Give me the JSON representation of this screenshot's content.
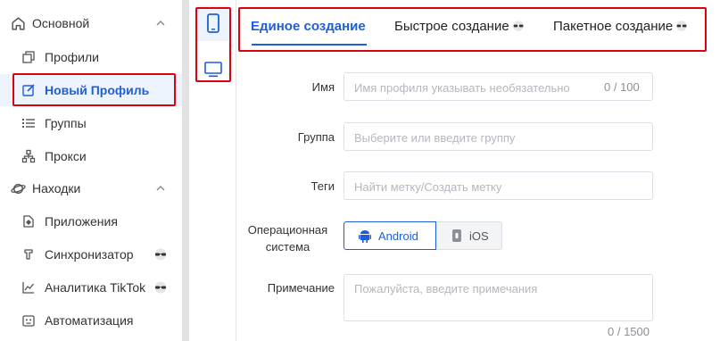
{
  "sidebar": {
    "groups": [
      {
        "label": "Основной",
        "icon": "home-icon"
      },
      {
        "label": "Находки",
        "icon": "planet-icon"
      }
    ],
    "items": [
      {
        "label": "Профили",
        "icon": "profiles-icon"
      },
      {
        "label": "Новый Профиль",
        "icon": "edit-icon",
        "active": true
      },
      {
        "label": "Группы",
        "icon": "list-icon"
      },
      {
        "label": "Прокси",
        "icon": "network-icon"
      },
      {
        "label": "Приложения",
        "icon": "apps-icon"
      },
      {
        "label": "Синхронизатор",
        "icon": "sync-icon",
        "badge": "vip-glasses-icon"
      },
      {
        "label": "Аналитика TikTok",
        "icon": "chart-icon",
        "badge": "vip-glasses-icon"
      },
      {
        "label": "Автоматизация",
        "icon": "robot-icon"
      }
    ]
  },
  "device_types": [
    {
      "icon": "phone-icon",
      "selected": true
    },
    {
      "icon": "desktop-icon",
      "selected": false
    }
  ],
  "tabs": [
    {
      "label": "Единое создание",
      "active": true
    },
    {
      "label": "Быстрое создание",
      "badge": "vip-glasses-icon"
    },
    {
      "label": "Пакетное создание",
      "badge": "vip-glasses-icon"
    }
  ],
  "form": {
    "name": {
      "label": "Имя",
      "placeholder": "Имя профиля указывать необязательно",
      "counter": "0 / 100"
    },
    "group": {
      "label": "Группа",
      "placeholder": "Выберите или введите группу"
    },
    "tags": {
      "label": "Теги",
      "placeholder": "Найти метку/Создать метку"
    },
    "os": {
      "label_line1": "Операционная",
      "label_line2": "система",
      "options": [
        {
          "label": "Android",
          "icon": "android-icon",
          "selected": true
        },
        {
          "label": "iOS",
          "icon": "apple-icon",
          "selected": false
        }
      ]
    },
    "note": {
      "label": "Примечание",
      "placeholder": "Пожалуйста, введите примечания",
      "counter": "0 / 1500"
    }
  },
  "colors": {
    "accent": "#1e5fd9",
    "highlight": "#d9040f",
    "active_bg": "#eef4fe"
  }
}
